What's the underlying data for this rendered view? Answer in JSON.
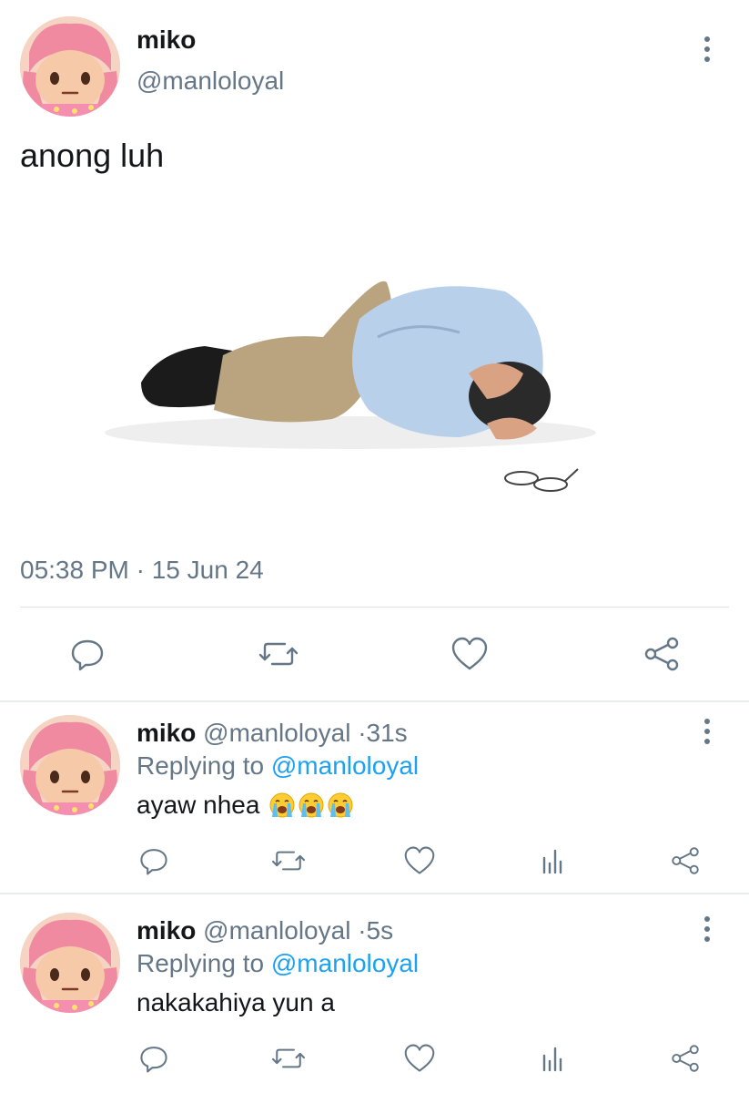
{
  "main_tweet": {
    "author_name": "miko",
    "author_handle": "@manloloyal",
    "text": "anong luh",
    "timestamp": "05:38 PM · 15 Jun 24",
    "image_icon": "person-curled-on-floor-photo"
  },
  "replies": [
    {
      "author_name": "miko",
      "author_handle": "@manloloyal",
      "separator": "·",
      "time": "31s",
      "replying_label": "Replying to",
      "replying_to": "@manloloyal",
      "text": "ayaw nhea",
      "emoji": [
        "loudly-crying-face",
        "loudly-crying-face",
        "loudly-crying-face"
      ]
    },
    {
      "author_name": "miko",
      "author_handle": "@manloloyal",
      "separator": "·",
      "time": "5s",
      "replying_label": "Replying to",
      "replying_to": "@manloloyal",
      "text": "nakakahiya yun a",
      "emoji": []
    }
  ],
  "colors": {
    "text": "#14171a",
    "secondary": "#657786",
    "link": "#1da1f2",
    "divider": "#e6ecf0"
  }
}
